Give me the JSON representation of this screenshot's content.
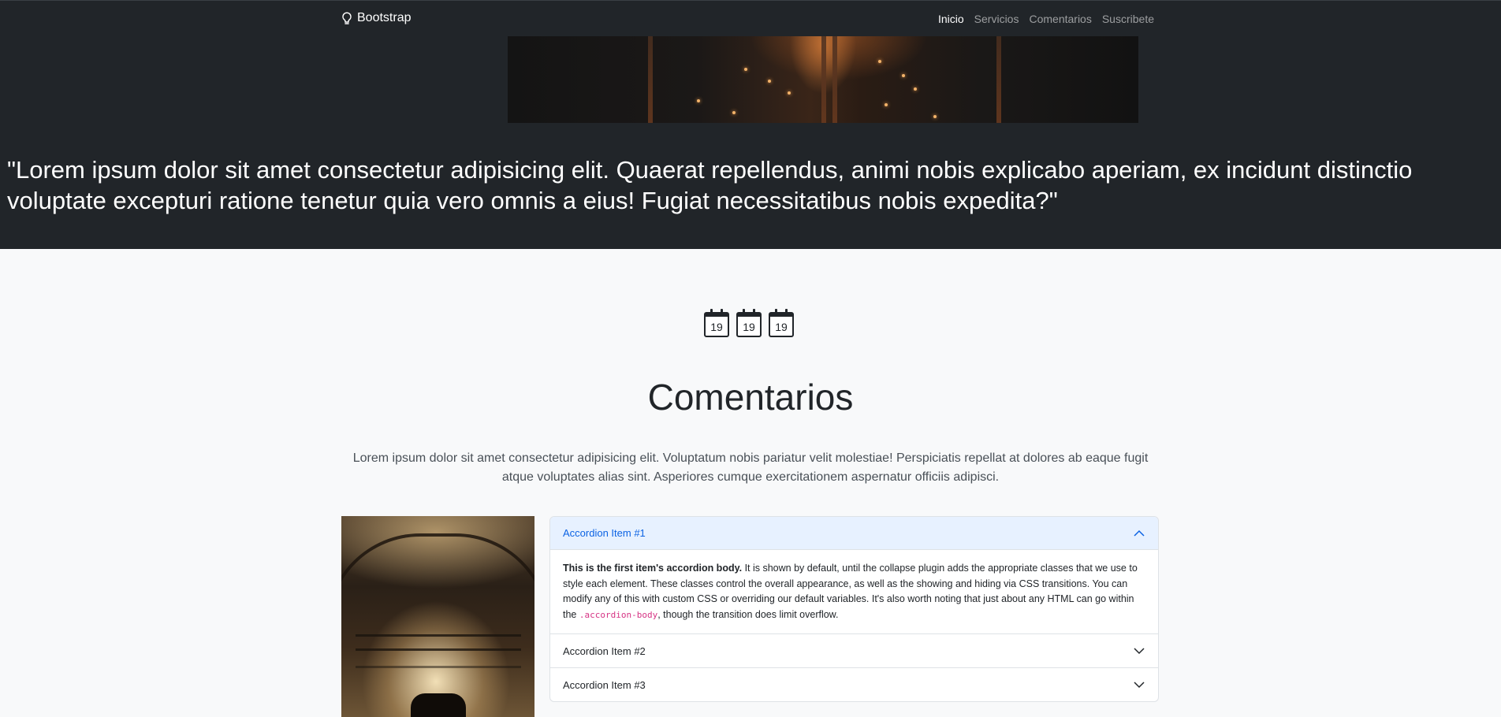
{
  "navbar": {
    "brand": "Bootstrap",
    "brand_icon": "lightbulb-icon",
    "links": [
      {
        "label": "Inicio",
        "active": true
      },
      {
        "label": "Servicios",
        "active": false
      },
      {
        "label": "Comentarios",
        "active": false
      },
      {
        "label": "Suscribete",
        "active": false
      }
    ]
  },
  "hero": {
    "quote": "\"Lorem ipsum dolor sit amet consectetur adipisicing elit. Quaerat repellendus, animi nobis explicabo aperiam, ex incidunt distinctio voluptate excepturi ratione tenetur quia vero omnis a eius! Fugiat necessitatibus nobis expedita?\""
  },
  "calendars": [
    "19",
    "19",
    "19"
  ],
  "comments": {
    "title": "Comentarios",
    "lead": "Lorem ipsum dolor sit amet consectetur adipisicing elit. Voluptatum nobis pariatur velit molestiae! Perspiciatis repellat at dolores ab eaque fugit atque voluptates alias sint. Asperiores cumque exercitationem aspernatur officiis adipisci."
  },
  "accordion": {
    "items": [
      {
        "title": "Accordion Item #1",
        "expanded": true
      },
      {
        "title": "Accordion Item #2",
        "expanded": false
      },
      {
        "title": "Accordion Item #3",
        "expanded": false
      }
    ],
    "body": {
      "strong": "This is the first item's accordion body.",
      "text_1": " It is shown by default, until the collapse plugin adds the appropriate classes that we use to style each element. These classes control the overall appearance, as well as the showing and hiding via CSS transitions. You can modify any of this with custom CSS or overriding our default variables. It's also worth noting that just about any HTML can go within the ",
      "code": ".accordion-body",
      "text_2": ", though the transition does limit overflow."
    }
  },
  "colors": {
    "dark_bg": "#212529",
    "light_bg": "#f8f9fa",
    "accordion_active_bg": "#e7f1ff",
    "accordion_active_text": "#0c63e4",
    "code_color": "#d63384"
  }
}
